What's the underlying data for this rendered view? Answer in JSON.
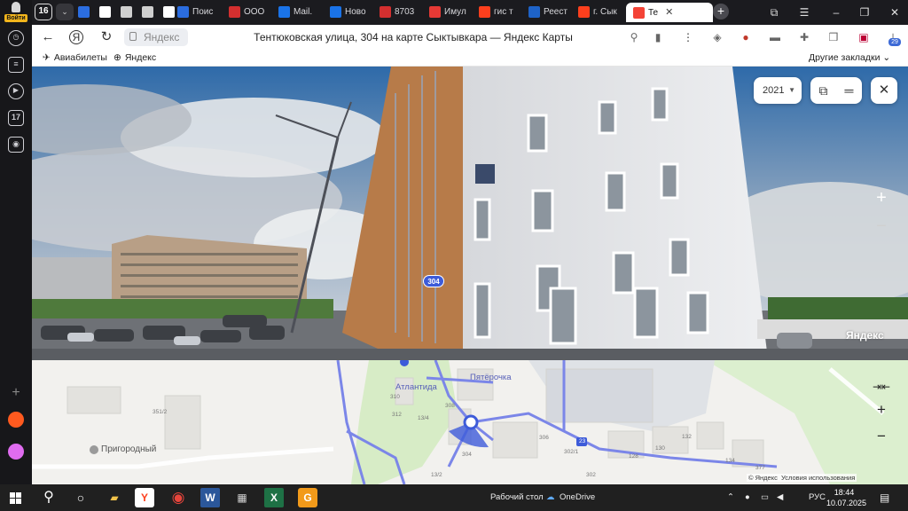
{
  "sidepanel": {
    "login_label": "Войти",
    "calendar_day": "17"
  },
  "tabs": {
    "count": "16",
    "items": [
      {
        "label": "",
        "icon": "cloud-icon",
        "color": "#2b6de0"
      },
      {
        "label": "",
        "icon": "document-icon",
        "color": "#ffffff"
      },
      {
        "label": "",
        "icon": "image-icon",
        "color": "#cfcfcf"
      },
      {
        "label": "",
        "icon": "image-icon",
        "color": "#cfcfcf"
      },
      {
        "label": "",
        "icon": "document-icon",
        "color": "#ffffff"
      },
      {
        "label": "Поис",
        "icon": "mail-icon",
        "color": "#2b6de0"
      },
      {
        "label": "ООО",
        "icon": "pdf-icon",
        "color": "#d32f2f"
      },
      {
        "label": "Mail.",
        "icon": "at-icon",
        "color": "#1a73e8"
      },
      {
        "label": "Ново",
        "icon": "at-icon",
        "color": "#1a73e8"
      },
      {
        "label": "8703",
        "icon": "pdf-icon",
        "color": "#d32f2f"
      },
      {
        "label": "Имул",
        "icon": "rtc-icon",
        "color": "#e53935"
      },
      {
        "label": "гис т",
        "icon": "yandex-icon",
        "color": "#fc3f1d"
      },
      {
        "label": "Реест",
        "icon": "shield-icon",
        "color": "#1e63c8"
      },
      {
        "label": "г. Сык",
        "icon": "yandex-icon",
        "color": "#fc3f1d"
      },
      {
        "label": "Те",
        "icon": "map-pin-icon",
        "color": "#f44336",
        "active": true
      }
    ]
  },
  "address": {
    "host": "Яндекс",
    "title": "Тентюковская улица, 304 на карте Сыктывкара — Яндекс Карты"
  },
  "bookmarks": {
    "items": [
      {
        "label": "Авиабилеты",
        "icon": "plane-icon"
      },
      {
        "label": "Яндекс",
        "icon": "plus-icon"
      }
    ],
    "other": "Другие закладки"
  },
  "panorama": {
    "year": "2021",
    "house_number": "304",
    "brand": "Яндекс"
  },
  "map": {
    "labels": {
      "atlantida": "Атлантида",
      "pyaterochka": "Пятёрочка",
      "prigorodny": "Пригородный"
    },
    "numbers": [
      "351/2",
      "310",
      "308",
      "306",
      "302/1",
      "304",
      "128",
      "130",
      "132",
      "134",
      "377",
      "13/4",
      "13/2",
      "312",
      "302",
      "23"
    ],
    "copyright": "© Яндекс",
    "terms": "Условия использования"
  },
  "extensions": {
    "badge": "29"
  },
  "taskbar": {
    "desktop_label": "Рабочий стол",
    "onedrive_label": "OneDrive",
    "lang": "РУС",
    "time": "18:44",
    "date": "10.07.2025"
  },
  "colors": {
    "tab_bg": "#1b1b1f",
    "accent_blue": "#3d5bd9",
    "map_road": "#7b86e8"
  }
}
